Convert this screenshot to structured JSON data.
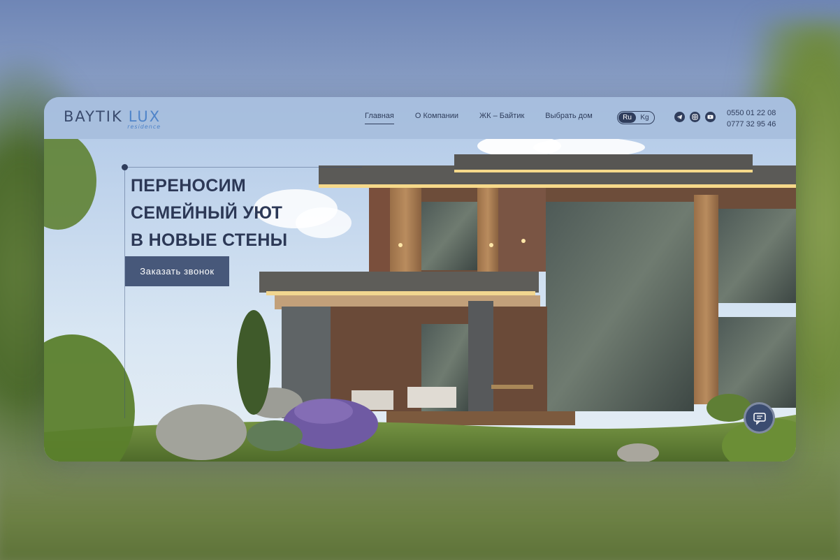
{
  "brand": {
    "name": "BAYTIK",
    "accent": "LUX",
    "sub": "residence"
  },
  "nav": {
    "items": [
      {
        "label": "Главная",
        "active": true
      },
      {
        "label": "О Компании",
        "active": false
      },
      {
        "label": "ЖК – Байтик",
        "active": false
      },
      {
        "label": "Выбрать дом",
        "active": false
      }
    ]
  },
  "lang": {
    "options": [
      "Ru",
      "Kg"
    ],
    "selected": "Ru"
  },
  "social": {
    "icons": [
      "telegram-icon",
      "instagram-icon",
      "youtube-icon"
    ]
  },
  "contacts": {
    "phones": [
      "0550 01 22 08",
      "0777 32 95 46"
    ]
  },
  "hero": {
    "title_lines": [
      "ПЕРЕНОСИМ",
      "СЕМЕЙНЫЙ УЮТ",
      "В НОВЫЕ СТЕНЫ"
    ],
    "cta_label": "Заказать звонок"
  },
  "colors": {
    "primary": "#47587a",
    "text": "#2c3856",
    "accent": "#4f84c9"
  }
}
